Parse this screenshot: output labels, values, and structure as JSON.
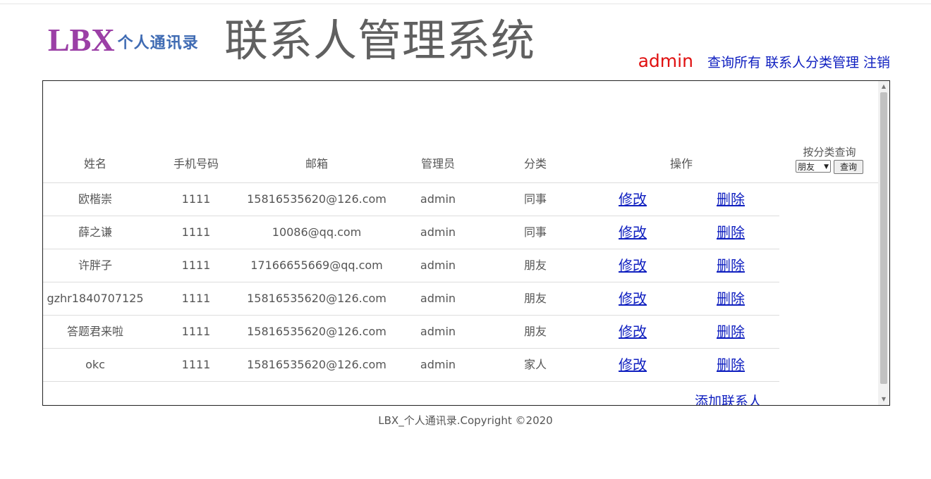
{
  "header": {
    "logo_main": "LBX",
    "logo_sub": "个人通讯录",
    "title": "联系人管理系统",
    "username": "admin",
    "nav": [
      "查询所有",
      "联系人分类管理",
      "注销"
    ]
  },
  "table": {
    "columns": [
      "姓名",
      "手机号码",
      "邮箱",
      "管理员",
      "分类",
      "操作"
    ],
    "filter_label": "按分类查询",
    "filter_selected": "朋友",
    "filter_button": "查询",
    "edit_label": "修改",
    "delete_label": "删除",
    "rows": [
      {
        "name": "欧楷崇",
        "phone": "1111",
        "email": "15816535620@126.com",
        "admin": "admin",
        "category": "同事"
      },
      {
        "name": "薛之谦",
        "phone": "1111",
        "email": "10086@qq.com",
        "admin": "admin",
        "category": "同事"
      },
      {
        "name": "许胖子",
        "phone": "1111",
        "email": "17166655669@qq.com",
        "admin": "admin",
        "category": "朋友"
      },
      {
        "name": "gzhr1840707125",
        "phone": "1111",
        "email": "15816535620@126.com",
        "admin": "admin",
        "category": "朋友"
      },
      {
        "name": "答题君来啦",
        "phone": "1111",
        "email": "15816535620@126.com",
        "admin": "admin",
        "category": "朋友"
      },
      {
        "name": "okc",
        "phone": "1111",
        "email": "15816535620@126.com",
        "admin": "admin",
        "category": "家人"
      }
    ],
    "add_link": "添加联系人"
  },
  "footer": {
    "text": "LBX_个人通讯录.Copyright ©2020"
  },
  "colors": {
    "username": "#e01010",
    "link": "#1020c0",
    "logo_main": "#9b3fa6",
    "logo_sub": "#3f6bb3"
  },
  "icons": {
    "scroll_up": "triangle-up-icon",
    "scroll_down": "triangle-down-icon",
    "select_arrow": "chevron-down-icon"
  }
}
